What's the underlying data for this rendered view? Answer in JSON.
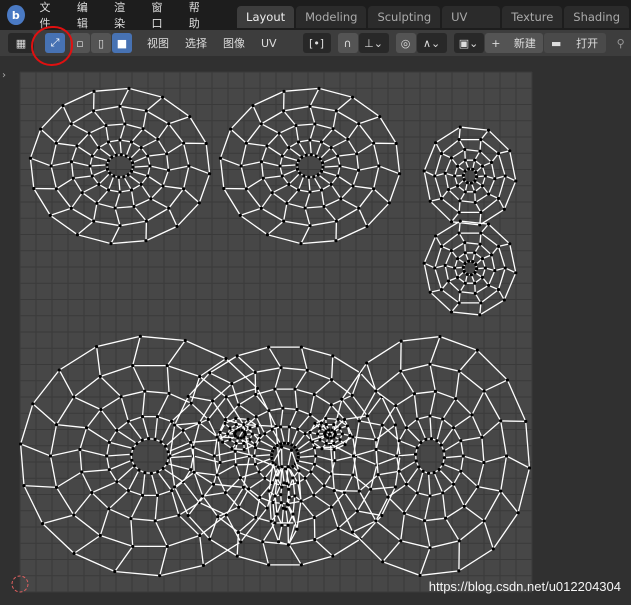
{
  "topbar": {
    "menus": [
      "文件",
      "编辑",
      "渲染",
      "窗口",
      "帮助"
    ],
    "workspaces": [
      "Layout",
      "Modeling",
      "Sculpting",
      "UV Editing",
      "Texture Paint",
      "Shading"
    ],
    "active_workspace": "Layout"
  },
  "header": {
    "menus": [
      "视图",
      "选择",
      "图像",
      "UV"
    ],
    "new_label": "新建",
    "open_label": "打开",
    "icons": [
      "editor-type-icon",
      "uv-sync-selection-icon",
      "vertex-select-icon",
      "edge-select-icon",
      "face-select-icon",
      "pivot-icon",
      "snap-icon",
      "snap-increment-icon",
      "proportional-edit-icon",
      "falloff-icon",
      "image-browse-icon",
      "plus-icon",
      "folder-icon",
      "pin-icon"
    ]
  },
  "colors": {
    "accent": "#4772b3",
    "annotation": "#e01010"
  },
  "watermark": "https://blog.csdn.net/u012204304"
}
